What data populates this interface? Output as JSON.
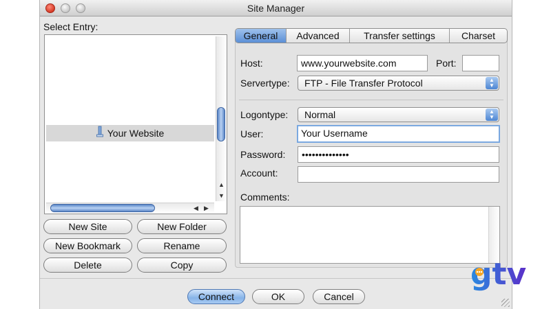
{
  "window": {
    "title": "Site Manager"
  },
  "entries": {
    "label": "Select Entry:",
    "items": [
      {
        "label": "Your Website",
        "icon": "server-icon"
      }
    ]
  },
  "buttons": {
    "new_site": "New Site",
    "new_folder": "New Folder",
    "new_bookmark": "New Bookmark",
    "rename": "Rename",
    "delete": "Delete",
    "copy": "Copy"
  },
  "tabs": [
    {
      "label": "General",
      "active": true
    },
    {
      "label": "Advanced",
      "active": false
    },
    {
      "label": "Transfer settings",
      "active": false
    },
    {
      "label": "Charset",
      "active": false
    }
  ],
  "form": {
    "host_label": "Host:",
    "host_value": "www.yourwebsite.com",
    "port_label": "Port:",
    "port_value": "",
    "servertype_label": "Servertype:",
    "servertype_value": "FTP - File Transfer Protocol",
    "logontype_label": "Logontype:",
    "logontype_value": "Normal",
    "user_label": "User:",
    "user_value": "Your Username",
    "password_label": "Password:",
    "password_value": "••••••••••••••",
    "account_label": "Account:",
    "account_value": "",
    "comments_label": "Comments:",
    "comments_value": ""
  },
  "footer": {
    "connect": "Connect",
    "ok": "OK",
    "cancel": "Cancel"
  },
  "logo": {
    "text": "gtv"
  },
  "colors": {
    "accent": "#5b8fd6",
    "logo_blue": "#2a8be0",
    "logo_purple": "#5b2ec8",
    "logo_orange": "#f6a623"
  }
}
